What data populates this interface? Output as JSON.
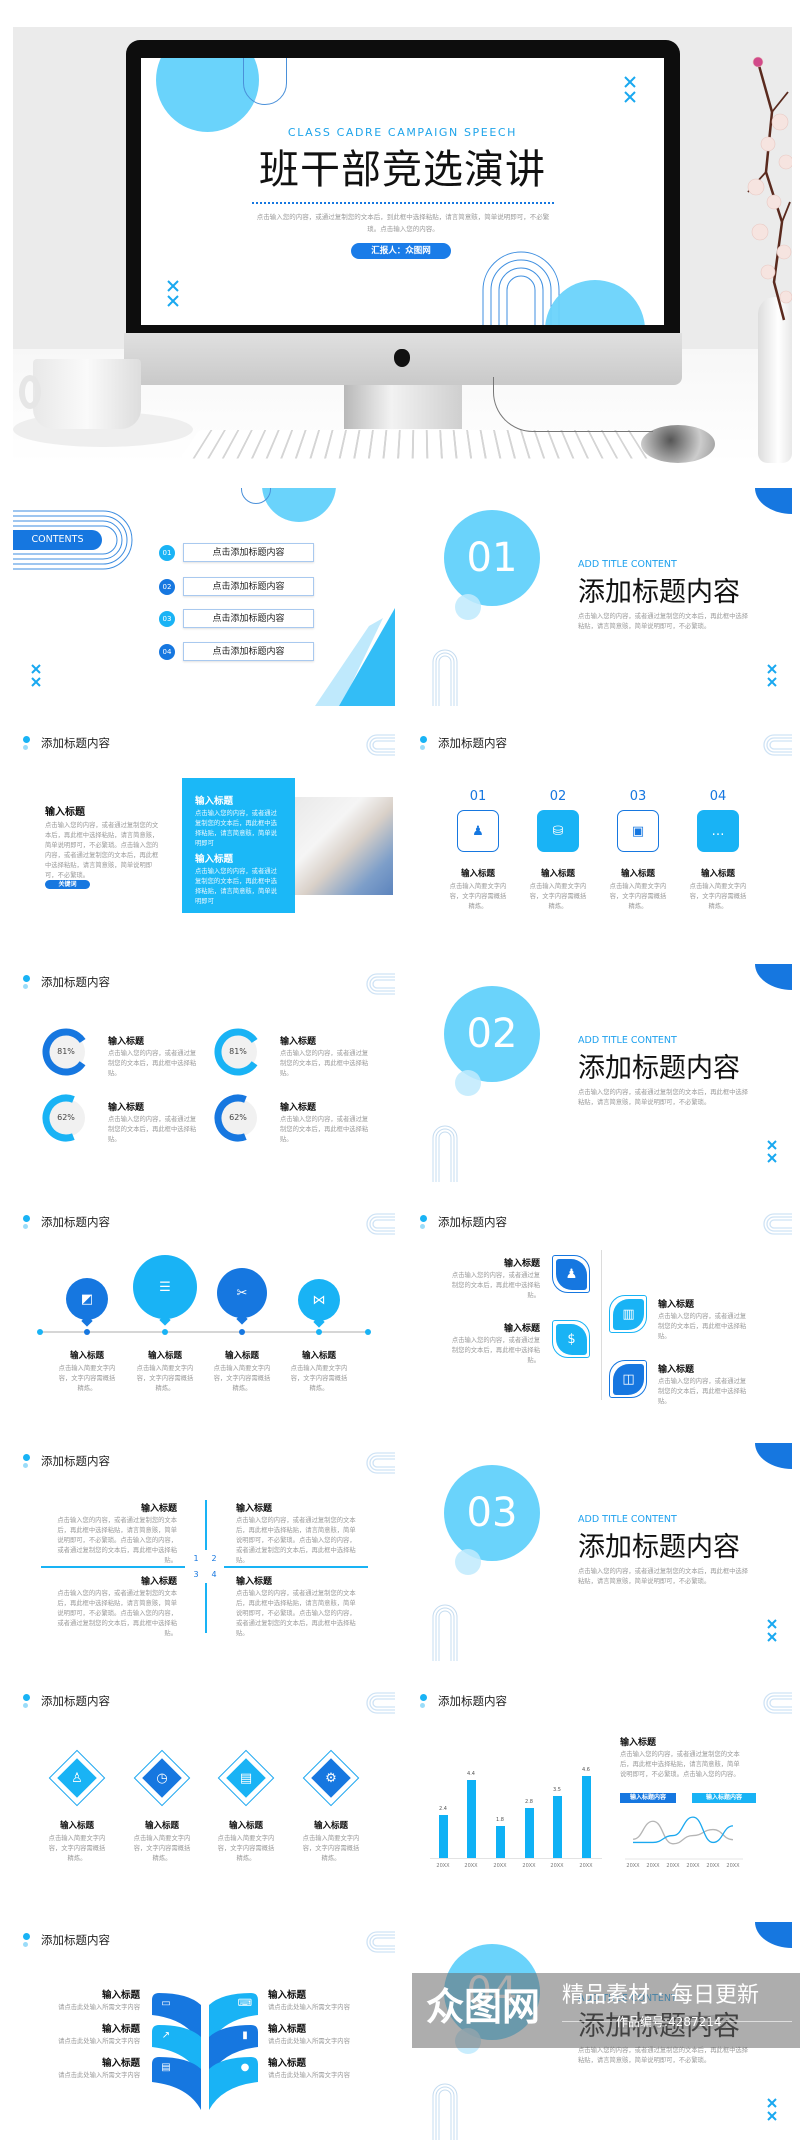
{
  "colors": {
    "dark_blue": "#1677e0",
    "light_blue": "#19b3f5",
    "pale_blue": "#6ad3fb",
    "text_gray": "#9a9a9a"
  },
  "hero": {
    "subtitle": "CLASS CADRE CAMPAIGN SPEECH",
    "title": "班干部竞选演讲",
    "desc": "点击输入您的内容，或通过复制您的文本后，到此框中选择粘贴，请言简意赅，简单说明即可，不必繁琐。点击输入您的内容。",
    "reporter": "汇报人：众图网"
  },
  "contents": {
    "label": "CONTENTS",
    "items": [
      {
        "num": "01",
        "text": "点击添加标题内容"
      },
      {
        "num": "02",
        "text": "点击添加标题内容"
      },
      {
        "num": "03",
        "text": "点击添加标题内容"
      },
      {
        "num": "04",
        "text": "点击添加标题内容"
      }
    ]
  },
  "sections": [
    {
      "num": "01",
      "en": "ADD TITLE CONTENT",
      "title": "添加标题内容",
      "desc": "点击输入您的内容，或者通过复制您的文本后，再此框中选择粘贴，请言简意赅，简单说明即可，不必繁琐。"
    },
    {
      "num": "02",
      "en": "ADD TITLE CONTENT",
      "title": "添加标题内容",
      "desc": "点击输入您的内容，或者通过复制您的文本后，再此框中选择粘贴，请言简意赅，简单说明即可，不必繁琐。"
    },
    {
      "num": "03",
      "en": "ADD TITLE CONTENT",
      "title": "添加标题内容",
      "desc": "点击输入您的内容，或者通过复制您的文本后，再此框中选择粘贴，请言简意赅，简单说明即可，不必繁琐。"
    },
    {
      "num": "04",
      "en": "ADD TITLE CONTENT",
      "title": "添加标题内容",
      "desc": "点击输入您的内容，或者通过复制您的文本后，再此框中选择粘贴，请言简意赅，简单说明即可，不必繁琐。"
    }
  ],
  "text_image": {
    "heading": "添加标题内容",
    "title": "输入标题",
    "body": "点击输入您的内容，或者通过复制您的文本后，再此框中选择粘贴，请言简意赅，简单说明即可，不必繁琐。点击输入您的内容，或者通过复制您的文本后，再此框中选择粘贴，请言简意赅，简单说明即可，不必繁琐。",
    "keyword": "关键词",
    "panel": [
      {
        "title": "输入标题",
        "body": "点击输入您的内容，或者通过复制您的文本后，再此框中选择粘贴，请言简意赅，简单说明即可"
      },
      {
        "title": "输入标题",
        "body": "点击输入您的内容，或者通过复制您的文本后，再此框中选择粘贴，请言简意赅，简单说明即可"
      }
    ]
  },
  "numbered_icons": {
    "heading": "添加标题内容",
    "items": [
      {
        "num": "01",
        "icon": "team-icon",
        "title": "输入标题",
        "body": "点击输入简要文字内容，文字内容需概括精炼。"
      },
      {
        "num": "02",
        "icon": "coins-icon",
        "title": "输入标题",
        "body": "点击输入简要文字内容，文字内容需概括精炼。"
      },
      {
        "num": "03",
        "icon": "briefcase-icon",
        "title": "输入标题",
        "body": "点击输入简要文字内容，文字内容需概括精炼。"
      },
      {
        "num": "04",
        "icon": "chat-icon",
        "title": "输入标题",
        "body": "点击输入简要文字内容，文字内容需概括精炼。"
      }
    ]
  },
  "progress": {
    "heading": "添加标题内容",
    "items": [
      {
        "percent": 81,
        "label": "81%",
        "title": "输入标题",
        "body": "点击输入您的内容，或者通过复制您的文本后，再此框中选择粘贴。"
      },
      {
        "percent": 81,
        "label": "81%",
        "title": "输入标题",
        "body": "点击输入您的内容，或者通过复制您的文本后，再此框中选择粘贴。"
      },
      {
        "percent": 62,
        "label": "62%",
        "title": "输入标题",
        "body": "点击输入您的内容，或者通过复制您的文本后，再此框中选择粘贴。"
      },
      {
        "percent": 62,
        "label": "62%",
        "title": "输入标题",
        "body": "点击输入您的内容，或者通过复制您的文本后，再此框中选择粘贴。"
      }
    ]
  },
  "timeline": {
    "heading": "添加标题内容",
    "items": [
      {
        "icon": "chart-icon",
        "title": "输入标题",
        "body": "点击输入简要文字内容，文字内容需概括精炼。"
      },
      {
        "icon": "document-icon",
        "title": "输入标题",
        "body": "点击输入简要文字内容，文字内容需概括精炼。"
      },
      {
        "icon": "tools-icon",
        "title": "输入标题",
        "body": "点击输入简要文字内容，文字内容需概括精炼。"
      },
      {
        "icon": "share-icon",
        "title": "输入标题",
        "body": "点击输入简要文字内容，文字内容需概括精炼。"
      }
    ]
  },
  "leaf_cards": {
    "heading": "添加标题内容",
    "items": [
      {
        "icon": "team-icon",
        "title": "输入标题",
        "body": "点击输入您的内容，或者通过复制您的文本后，再此框中选择粘贴。"
      },
      {
        "icon": "bar-chart-icon",
        "title": "输入标题",
        "body": "点击输入您的内容，或者通过复制您的文本后，再此框中选择粘贴。"
      },
      {
        "icon": "money-bag-icon",
        "title": "输入标题",
        "body": "点击输入您的内容，或者通过复制您的文本后，再此框中选择粘贴。"
      },
      {
        "icon": "presentation-icon",
        "title": "输入标题",
        "body": "点击输入您的内容，或者通过复制您的文本后，再此框中选择粘贴。"
      }
    ]
  },
  "quadrants": {
    "heading": "添加标题内容",
    "numbers": [
      "1",
      "2",
      "3",
      "4"
    ],
    "items": [
      {
        "title": "输入标题",
        "body": "点击输入您的内容，或者通过复制您的文本后，再此框中选择粘贴，请言简意赅，简单说明即可，不必繁琐。点击输入您的内容，或者通过复制您的文本后，再此框中选择粘贴。"
      },
      {
        "title": "输入标题",
        "body": "点击输入您的内容，或者通过复制您的文本后，再此框中选择粘贴，请言简意赅，简单说明即可，不必繁琐。点击输入您的内容，或者通过复制您的文本后，再此框中选择粘贴。"
      },
      {
        "title": "输入标题",
        "body": "点击输入您的内容，或者通过复制您的文本后，再此框中选择粘贴，请言简意赅，简单说明即可，不必繁琐。点击输入您的内容，或者通过复制您的文本后，再此框中选择粘贴。"
      },
      {
        "title": "输入标题",
        "body": "点击输入您的内容，或者通过复制您的文本后，再此框中选择粘贴，请言简意赅，简单说明即可，不必繁琐。点击输入您的内容，或者通过复制您的文本后，再此框中选择粘贴。"
      }
    ]
  },
  "diamonds": {
    "heading": "添加标题内容",
    "items": [
      {
        "icon": "presenter-icon",
        "title": "输入标题",
        "body": "点击输入简要文字内容，文字内容需概括精炼。"
      },
      {
        "icon": "calendar-icon",
        "title": "输入标题",
        "body": "点击输入简要文字内容，文字内容需概括精炼。"
      },
      {
        "icon": "tablet-icon",
        "title": "输入标题",
        "body": "点击输入简要文字内容，文字内容需概括精炼。"
      },
      {
        "icon": "settings-icon",
        "title": "输入标题",
        "body": "点击输入简要文字内容，文字内容需概括精炼。"
      }
    ]
  },
  "chart_slide": {
    "heading": "添加标题内容",
    "title": "输入标题",
    "body": "点击输入您的内容，或者通过复制您的文本后，再此框中选择粘贴，请言简意赅，简单说明即可，不必繁琐。点击输入您的内容。",
    "legend": [
      "输入标题内容",
      "输入标题内容"
    ]
  },
  "chart_data": [
    {
      "type": "bar",
      "categories": [
        "20XX",
        "20XX",
        "20XX",
        "20XX",
        "20XX",
        "20XX"
      ],
      "values": [
        2.4,
        4.4,
        1.8,
        2.8,
        3.5,
        4.6
      ],
      "data_labels": [
        "2.4",
        "4.4",
        "1.8",
        "2.8",
        "3.5",
        "4.6"
      ],
      "ylim": [
        0,
        5
      ],
      "grid": false,
      "color": "#0fb1f5"
    },
    {
      "type": "line",
      "categories": [
        "20XX",
        "20XX",
        "20XX",
        "20XX",
        "20XX",
        "20XX"
      ],
      "series": [
        {
          "values": [
            3.6,
            3.6,
            5.1,
            9.1,
            3.6,
            7.2
          ],
          "color": "#1aa8ef"
        },
        {
          "values": [
            4.3,
            8.2,
            3.3,
            5.1,
            6.4,
            4.2
          ],
          "color": "#b5b5b5"
        }
      ],
      "ylim": [
        0,
        10
      ],
      "grid": false,
      "smooth": true
    }
  ],
  "leaves": {
    "heading": "添加标题内容",
    "items": [
      {
        "icon": "monitor-icon",
        "title": "输入标题",
        "body": "请点击此处输入所需文字内容"
      },
      {
        "icon": "laptop-icon",
        "title": "输入标题",
        "body": "请点击此处输入所需文字内容"
      },
      {
        "icon": "trend-icon",
        "title": "输入标题",
        "body": "请点击此处输入所需文字内容"
      },
      {
        "icon": "building-icon",
        "title": "输入标题",
        "body": "请点击此处输入所需文字内容"
      },
      {
        "icon": "book-icon",
        "title": "输入标题",
        "body": "请点击此处输入所需文字内容"
      },
      {
        "icon": "lightbulb-icon",
        "title": "输入标题",
        "body": "请点击此处输入所需文字内容"
      }
    ]
  },
  "watermark": {
    "logo": "众图网",
    "slogan": "精品素材 · 每日更新",
    "code": "作品编号:4287214"
  }
}
